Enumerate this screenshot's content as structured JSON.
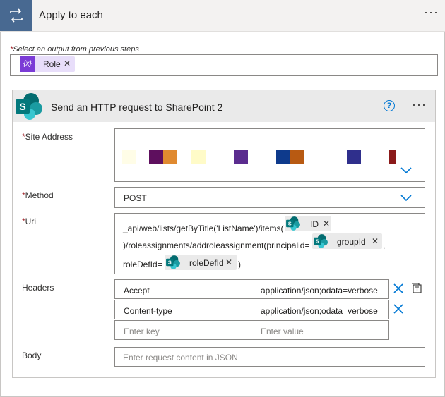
{
  "outer": {
    "title": "Apply to each"
  },
  "select_output": {
    "label": "Select an output from previous steps",
    "token": {
      "icon_text": "{x}",
      "label": "Role"
    }
  },
  "action": {
    "title": "Send an HTTP request to SharePoint 2",
    "help_glyph": "?",
    "site_address": {
      "label": "Site Address"
    },
    "method": {
      "label": "Method",
      "value": "POST"
    },
    "uri": {
      "label": "Uri",
      "text1": "_api/web/lists/getByTitle('ListName')/items(",
      "token1": "ID",
      "text2": ")/roleassignments/addroleassignment(principalid=",
      "token2": "groupId",
      "text3": ",",
      "text4": "roleDefId=",
      "token3": "roleDefId",
      "text5": ")"
    },
    "headers": {
      "label": "Headers",
      "rows": [
        {
          "key": "Accept",
          "value": "application/json;odata=verbose"
        },
        {
          "key": "Content-type",
          "value": "application/json;odata=verbose"
        }
      ],
      "key_placeholder": "Enter key",
      "value_placeholder": "Enter value"
    },
    "body": {
      "label": "Body",
      "placeholder": "Enter request content in JSON"
    }
  },
  "colors": {
    "loop_icon_bg": "#486991",
    "variable_token": "#7b3bd6",
    "sharepoint": "#038387",
    "accent": "#0078d4",
    "required": "#a4262c"
  }
}
